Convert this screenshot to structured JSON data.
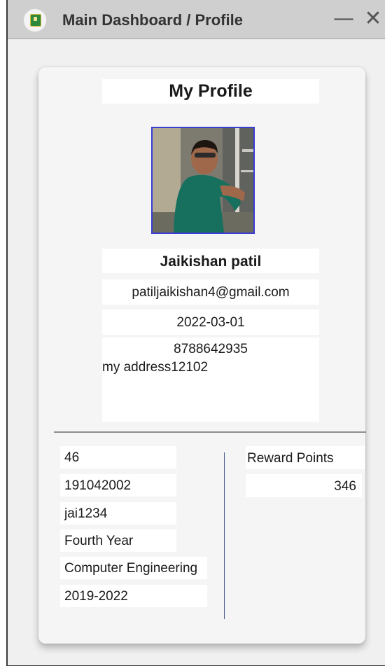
{
  "window": {
    "title": "Main Dashboard / Profile",
    "minimize_glyph": "—",
    "close_glyph": "✕",
    "icon": "app-logo-icon"
  },
  "profile": {
    "heading": "My Profile",
    "photo": "profile-photo",
    "name": "Jaikishan patil",
    "email": "patiljaikishan4@gmail.com",
    "date": "2022-03-01",
    "phone": "8788642935",
    "address": "my address12102"
  },
  "details": {
    "fields": [
      "46",
      "191042002",
      "jai1234",
      "Fourth Year",
      "Computer Engineering",
      "2019-2022"
    ]
  },
  "rewards": {
    "label": "Reward Points",
    "value": "346"
  },
  "colors": {
    "titlebar": "#cfcfcf",
    "card": "#f5f5f5",
    "photo_border": "#3a3ed0",
    "divider": "#8e8e8e"
  }
}
